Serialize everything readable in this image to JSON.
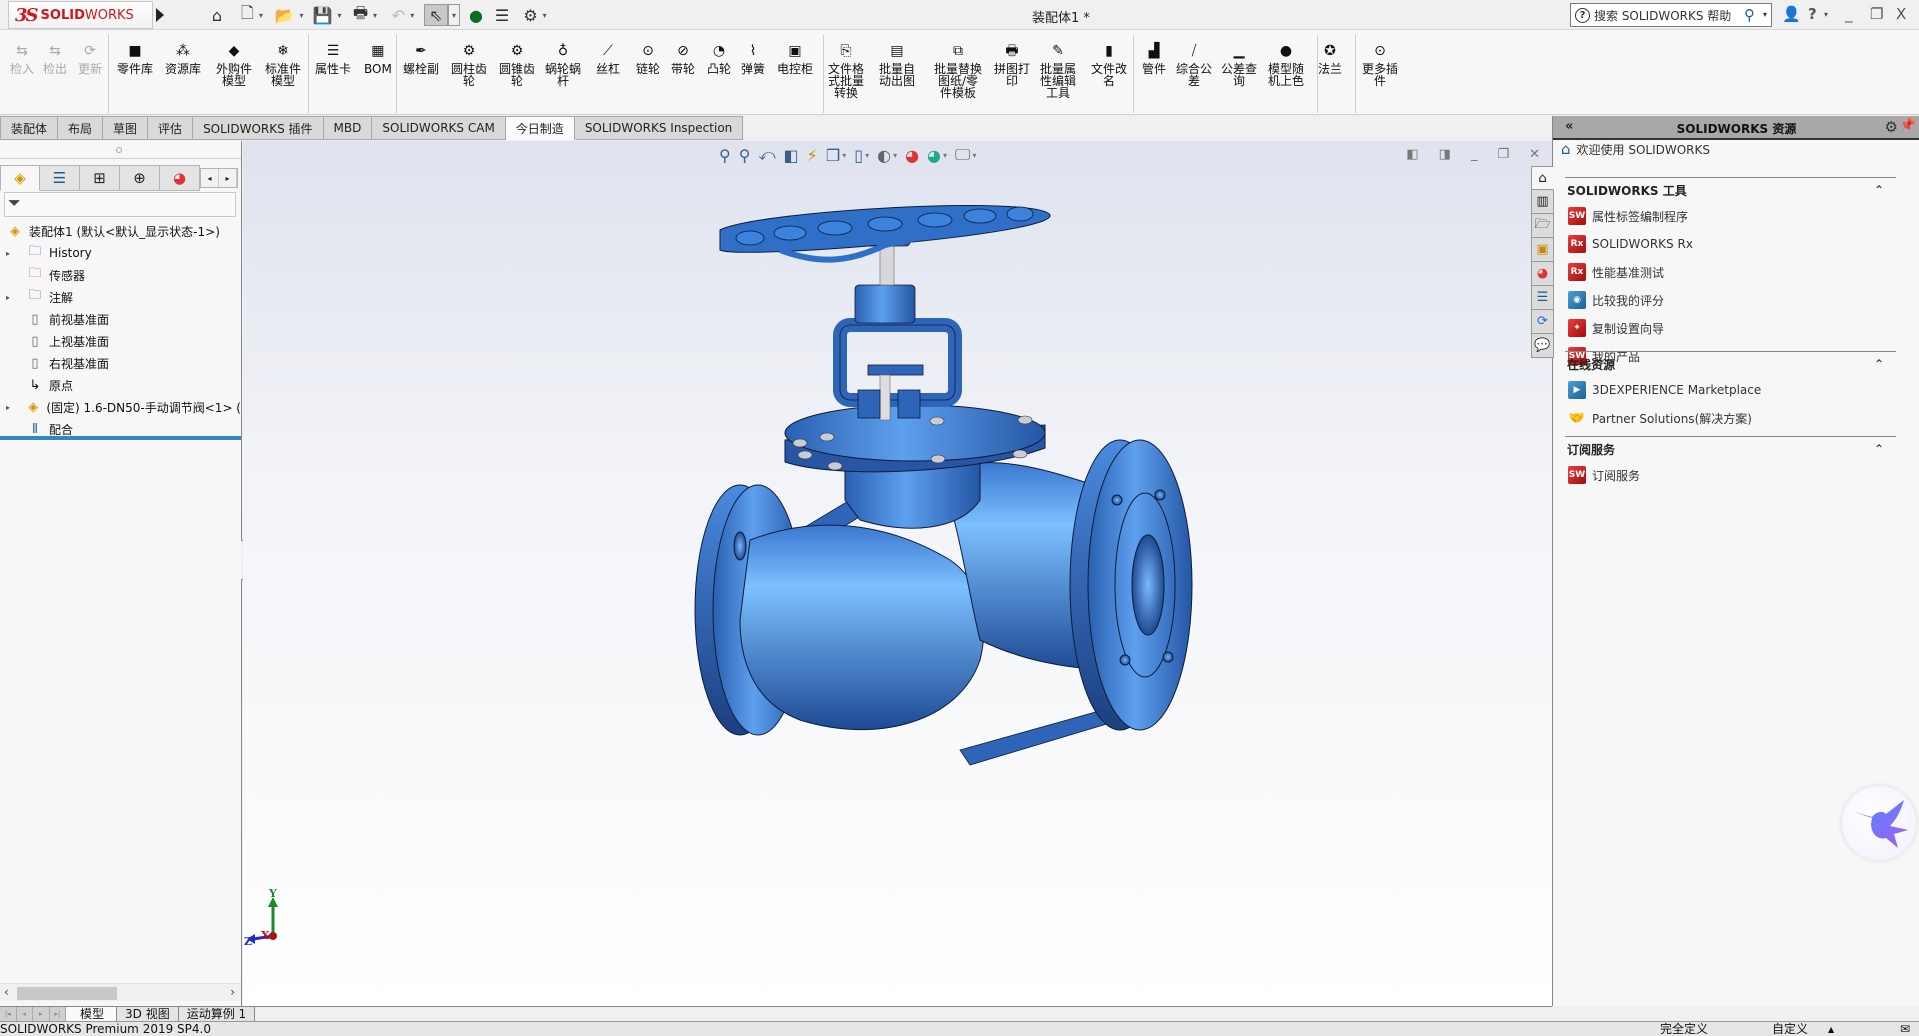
{
  "app": {
    "brand_ds": "3S",
    "brand_solid": "SOLID",
    "brand_works": "WORKS",
    "document_title": "装配体1 *",
    "search_placeholder": "搜索 SOLIDWORKS 帮助",
    "quick_access": [
      {
        "name": "home",
        "icon": "⌂"
      },
      {
        "name": "new",
        "icon": "🗋"
      },
      {
        "name": "open",
        "icon": "📂"
      },
      {
        "name": "save",
        "icon": "💾"
      },
      {
        "name": "print",
        "icon": "🖶"
      },
      {
        "name": "undo",
        "icon": "↶"
      },
      {
        "name": "select",
        "icon": "⇖"
      },
      {
        "name": "rebuild",
        "icon": "●"
      },
      {
        "name": "file-properties",
        "icon": "☰"
      },
      {
        "name": "options",
        "icon": "⚙"
      }
    ],
    "window_buttons": {
      "user": "👤",
      "help": "?",
      "minimize": "_",
      "restore": "❐",
      "close": "X"
    }
  },
  "ribbon": {
    "buttons": [
      {
        "label": "检入",
        "icon": "⇆",
        "disabled": true
      },
      {
        "label": "检出",
        "icon": "⇆",
        "disabled": true
      },
      {
        "label": "更新",
        "icon": "⟳",
        "disabled": true
      },
      {
        "label": "零件库",
        "icon": "■"
      },
      {
        "label": "资源库",
        "icon": "⁂"
      },
      {
        "label": "外购件\n模型",
        "icon": "◆"
      },
      {
        "label": "标准件\n模型",
        "icon": "❄"
      },
      {
        "label": "属性卡",
        "icon": "☰"
      },
      {
        "label": "BOM",
        "icon": "▦"
      },
      {
        "label": "螺栓副",
        "icon": "✒"
      },
      {
        "label": "圆柱齿\n轮",
        "icon": "⚙"
      },
      {
        "label": "圆锥齿\n轮",
        "icon": "⚙"
      },
      {
        "label": "蜗轮蜗\n杆",
        "icon": "♁"
      },
      {
        "label": "丝杠",
        "icon": "⟋"
      },
      {
        "label": "链轮",
        "icon": "⊙"
      },
      {
        "label": "带轮",
        "icon": "⊘"
      },
      {
        "label": "凸轮",
        "icon": "◔"
      },
      {
        "label": "弹簧",
        "icon": "⌇"
      },
      {
        "label": "电控柜",
        "icon": "▣"
      },
      {
        "label": "文件格\n式批量\n转换",
        "icon": "⎘"
      },
      {
        "label": "批量自\n动出图",
        "icon": "▤"
      },
      {
        "label": "批量替换\n图纸/零\n件模板",
        "icon": "⧉"
      },
      {
        "label": "拼图打\n印",
        "icon": "🖶"
      },
      {
        "label": "批量属\n性编辑\n工具",
        "icon": "✎"
      },
      {
        "label": "文件改\n名",
        "icon": "▮"
      },
      {
        "label": "管件",
        "icon": "▟"
      },
      {
        "label": "综合公\n差",
        "icon": "⧸"
      },
      {
        "label": "公差查\n询",
        "icon": "▁"
      },
      {
        "label": "模型随\n机上色",
        "icon": "●"
      },
      {
        "label": "法兰",
        "icon": "✪"
      },
      {
        "label": "更多插\n件",
        "icon": "⊙"
      }
    ]
  },
  "command_tabs": [
    {
      "label": "装配体",
      "active": false
    },
    {
      "label": "布局",
      "active": false
    },
    {
      "label": "草图",
      "active": false
    },
    {
      "label": "评估",
      "active": false
    },
    {
      "label": "SOLIDWORKS 插件",
      "active": false
    },
    {
      "label": "MBD",
      "active": false
    },
    {
      "label": "SOLIDWORKS CAM",
      "active": false
    },
    {
      "label": "今日制造",
      "active": true
    },
    {
      "label": "SOLIDWORKS Inspection",
      "active": false
    }
  ],
  "feature_manager": {
    "tabs": [
      {
        "name": "featuremanager",
        "icon": "◈"
      },
      {
        "name": "propertymanager",
        "icon": "☰"
      },
      {
        "name": "configurationmanager",
        "icon": "⊞"
      },
      {
        "name": "dimxpertmanager",
        "icon": "⊕"
      },
      {
        "name": "displaymanager",
        "icon": "◕"
      }
    ],
    "filter_icon": "⏷",
    "tree": [
      {
        "label": "装配体1  (默认<默认_显示状态-1>)",
        "icon": "assembly",
        "expander": false,
        "indent": 0
      },
      {
        "label": "History",
        "icon": "history-folder",
        "expander": true,
        "indent": 1
      },
      {
        "label": "传感器",
        "icon": "sensor-folder",
        "expander": false,
        "indent": 1
      },
      {
        "label": "注解",
        "icon": "annotation-folder",
        "expander": true,
        "indent": 1
      },
      {
        "label": "前视基准面",
        "icon": "plane",
        "expander": false,
        "indent": 1
      },
      {
        "label": "上视基准面",
        "icon": "plane",
        "expander": false,
        "indent": 1
      },
      {
        "label": "右视基准面",
        "icon": "plane",
        "expander": false,
        "indent": 1
      },
      {
        "label": "原点",
        "icon": "origin",
        "expander": false,
        "indent": 1
      },
      {
        "label": "(固定) 1.6-DN50-手动调节阀<1> (",
        "icon": "subassembly",
        "expander": true,
        "indent": 1
      },
      {
        "label": "配合",
        "icon": "mates",
        "expander": false,
        "indent": 1
      }
    ]
  },
  "viewport": {
    "heads_up_toolbar": [
      "zoom-to-fit",
      "zoom-to-area",
      "previous-view",
      "section-view",
      "dynamic-annotation",
      "view-orientation",
      "display-style",
      "hide-show-items",
      "edit-appearance",
      "apply-scene",
      "view-settings"
    ],
    "window_controls": [
      "tile-left",
      "tile-right",
      "minimize",
      "restore",
      "close"
    ],
    "triad_labels": {
      "x": "X",
      "y": "Y",
      "z": "Z"
    },
    "model_color": "#3a78d0"
  },
  "task_pane": {
    "title": "SOLIDWORKS 资源",
    "welcome": "欢迎使用  SOLIDWORKS",
    "tabs": [
      "home",
      "design-library",
      "file-explorer",
      "view-palette",
      "appearances",
      "custom-properties",
      "solidworks-forum",
      "solidworks-community"
    ],
    "sections": [
      {
        "title": "SOLIDWORKS 工具",
        "items": [
          {
            "label": "属性标签编制程序",
            "icon": "property-tab-builder"
          },
          {
            "label": "SOLIDWORKS Rx",
            "icon": "solidworks-rx"
          },
          {
            "label": "性能基准测试",
            "icon": "performance-benchmark"
          },
          {
            "label": "比较我的评分",
            "icon": "compare-score"
          },
          {
            "label": "复制设置向导",
            "icon": "copy-settings-wizard"
          },
          {
            "label": "我的产品",
            "icon": "my-products"
          }
        ]
      },
      {
        "title": "在线资源",
        "items": [
          {
            "label": "3DEXPERIENCE Marketplace",
            "icon": "marketplace"
          },
          {
            "label": "Partner Solutions(解决方案)",
            "icon": "partner-solutions"
          }
        ]
      },
      {
        "title": "订阅服务",
        "items": [
          {
            "label": "订阅服务",
            "icon": "subscription-services"
          }
        ]
      }
    ]
  },
  "bottom_tabs": [
    {
      "label": "模型",
      "active": true
    },
    {
      "label": "3D 视图",
      "active": false
    },
    {
      "label": "运动算例 1",
      "active": false
    }
  ],
  "status_bar": {
    "product": "SOLIDWORKS Premium 2019 SP4.0",
    "definition": "完全定义",
    "units": "自定义"
  }
}
